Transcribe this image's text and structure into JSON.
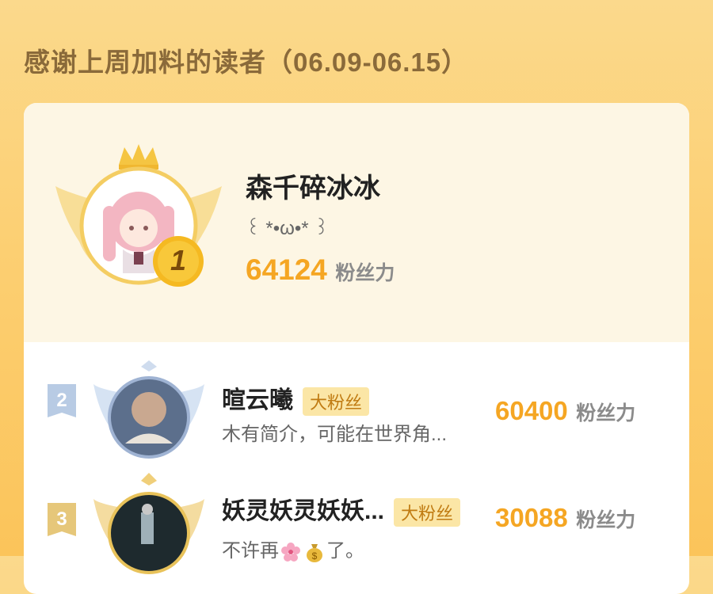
{
  "header": {
    "title": "感谢上周加料的读者（06.09-06.15）"
  },
  "colors": {
    "accent": "#f5a623",
    "tag_bg": "#fbe6a6",
    "tag_text": "#c07b12"
  },
  "top_reader": {
    "rank": "1",
    "name": "森千碎冰冰",
    "bio": "꒰ *•ω•* ꒱",
    "score": "64124",
    "score_unit": "粉丝力",
    "avatar_icon": "pink-hair-girl-avatar",
    "badge_icon": "crown-icon"
  },
  "readers": [
    {
      "rank": "2",
      "name": "暄云曦",
      "tag": "大粉丝",
      "bio": "木有简介，可能在世界角...",
      "score": "60400",
      "score_unit": "粉丝力"
    },
    {
      "rank": "3",
      "name": "妖灵妖灵妖妖...",
      "tag": "大粉丝",
      "bio_prefix": "不许再",
      "bio_suffix": "了。",
      "bio_emojis": [
        "cherry-blossom-icon",
        "money-bag-icon"
      ],
      "score": "30088",
      "score_unit": "粉丝力"
    }
  ]
}
